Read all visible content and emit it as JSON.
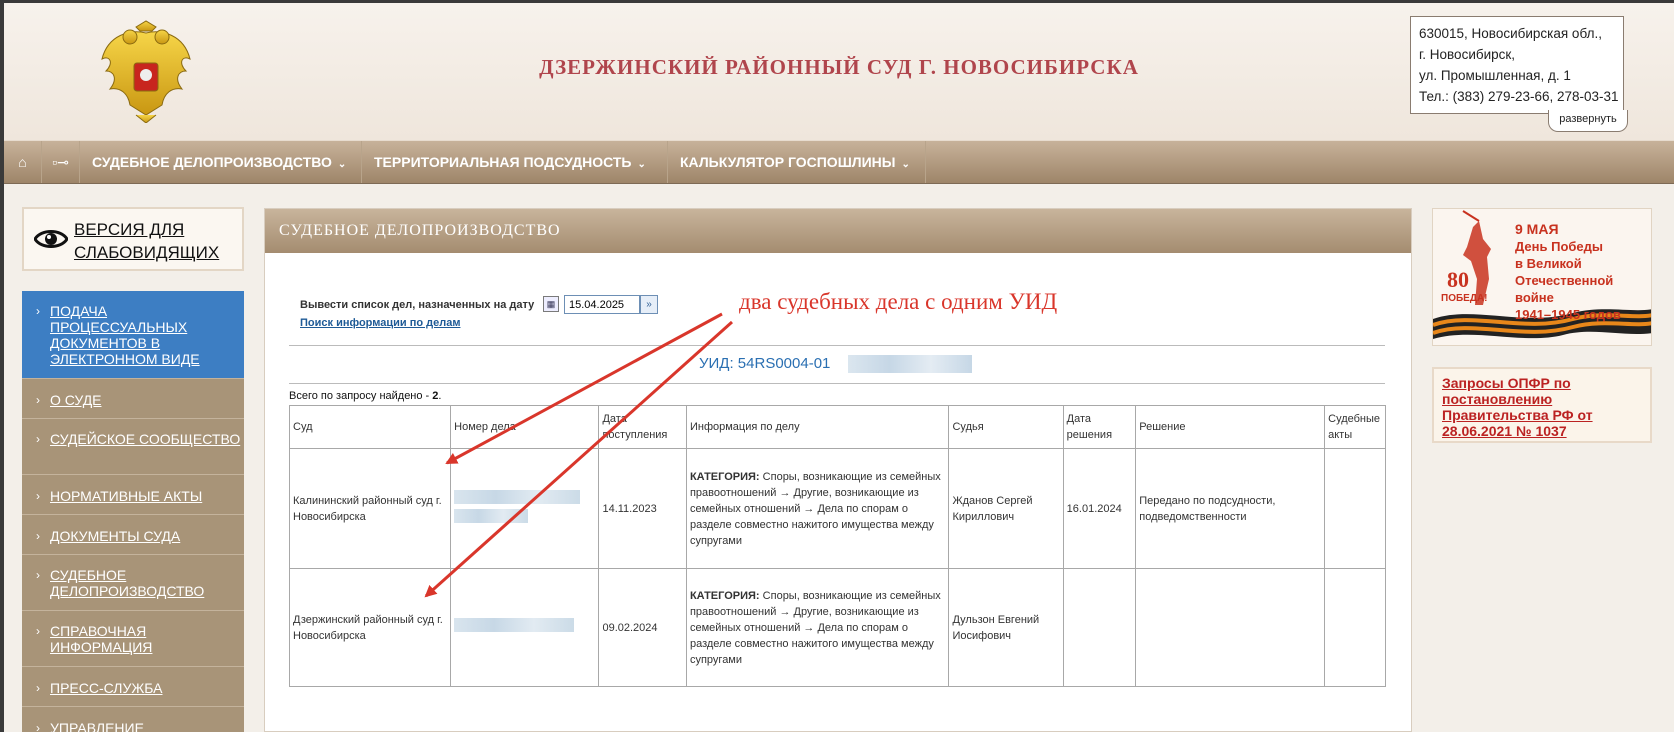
{
  "header": {
    "court_title": "ДЗЕРЖИНСКИЙ РАЙОННЫЙ СУД Г. НОВОСИБИРСКА",
    "address_lines": [
      "630015, Новосибирская обл.,",
      "г. Новосибирск,",
      "ул. Промышленная, д. 1",
      "Тел.: (383) 279-23-66, 278-03-31"
    ],
    "expand_label": "развернуть"
  },
  "nav": {
    "home_icon": "home-icon",
    "sitemap_icon": "sitemap-icon",
    "items": [
      {
        "label": "СУДЕБНОЕ ДЕЛОПРОИЗВОДСТВО"
      },
      {
        "label": "ТЕРРИТОРИАЛЬНАЯ ПОДСУДНОСТЬ"
      },
      {
        "label": "КАЛЬКУЛЯТОР ГОСПОШЛИНЫ"
      }
    ]
  },
  "sidebar": {
    "vision_label": "ВЕРСИЯ ДЛЯ СЛАБОВИДЯЩИХ",
    "items": [
      {
        "label": "ПОДАЧА ПРОЦЕССУАЛЬНЫХ ДОКУМЕНТОВ В ЭЛЕКТРОННОМ ВИДЕ",
        "active": true
      },
      {
        "label": "О СУДЕ"
      },
      {
        "label": "СУДЕЙСКОЕ СООБЩЕСТВО"
      },
      {
        "label": "НОРМАТИВНЫЕ АКТЫ"
      },
      {
        "label": "ДОКУМЕНТЫ СУДА"
      },
      {
        "label": "СУДЕБНОЕ ДЕЛОПРОИЗВОДСТВО"
      },
      {
        "label": "СПРАВОЧНАЯ ИНФОРМАЦИЯ"
      },
      {
        "label": "ПРЕСС-СЛУЖБА"
      },
      {
        "label": "УПРАВЛЕНИЕ"
      }
    ]
  },
  "main": {
    "title": "СУДЕБНОЕ ДЕЛОПРОИЗВОДСТВО",
    "date_label": "Вывести список дел, назначенных на дату",
    "date_value": "15.04.2025",
    "search_link": "Поиск информации по делам",
    "uid": "УИД: 54RS0004-01",
    "annotation": "два судебных дела с одним УИД",
    "found_text": "Всего по запросу найдено - ",
    "found_count": "2",
    "found_suffix": ".",
    "table": {
      "headers": [
        "Суд",
        "Номер дела",
        "Дата поступления",
        "Информация по делу",
        "Судья",
        "Дата решения",
        "Решение",
        "Судебные акты"
      ],
      "rows": [
        {
          "court": "Калининский районный суд г. Новосибирска",
          "date_in": "14.11.2023",
          "cat_label": "КАТЕГОРИЯ:",
          "cat_text": "Споры, возникающие из семейных правоотношений → Другие, возникающие из семейных отношений → Дела по спорам о разделе совместно нажитого имущества между супругами",
          "judge": "Жданов Сергей Кириллович",
          "date_decision": "16.01.2024",
          "decision": "Передано по подсудности, подведомственности",
          "acts": ""
        },
        {
          "court": "Дзержинский районный суд г. Новосибирска",
          "date_in": "09.02.2024",
          "cat_label": "КАТЕГОРИЯ:",
          "cat_text": "Споры, возникающие из семейных правоотношений → Другие, возникающие из семейных отношений → Дела по спорам о разделе совместно нажитого имущества между супругами",
          "judge": "Дульзон Евгений Иосифович",
          "date_decision": "",
          "decision": "",
          "acts": ""
        }
      ]
    }
  },
  "right": {
    "banner_lines": [
      "9 МАЯ",
      "День Победы",
      "в Великой",
      "Отечественной войне",
      "1941–1945 годов"
    ],
    "banner_badge": "80",
    "banner_badge_text": "ПОБЕДА!",
    "opfr_link": "Запросы ОПФР по постановлению Правительства РФ от 28.06.2021 № 1037"
  },
  "colors": {
    "title_red": "#b0454c",
    "nav_brown": "#a48c70",
    "active_blue": "#3d7ec3",
    "annotation_red": "#d9362b"
  }
}
